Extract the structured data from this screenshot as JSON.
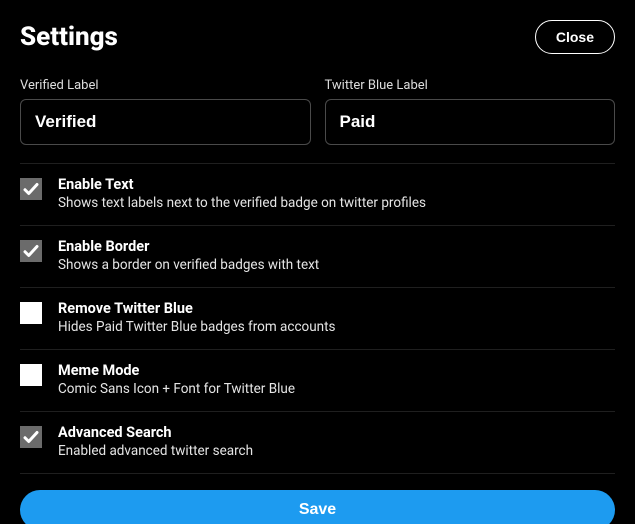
{
  "header": {
    "title": "Settings",
    "close_label": "Close"
  },
  "fields": {
    "verified": {
      "label": "Verified Label",
      "value": "Verified"
    },
    "twitter_blue": {
      "label": "Twitter Blue Label",
      "value": "Paid"
    }
  },
  "options": [
    {
      "title": "Enable Text",
      "desc": "Shows text labels next to the verified badge on twitter profiles",
      "checked": true
    },
    {
      "title": "Enable Border",
      "desc": "Shows a border on verified badges with text",
      "checked": true
    },
    {
      "title": "Remove Twitter Blue",
      "desc": "Hides Paid Twitter Blue badges from accounts",
      "checked": false
    },
    {
      "title": "Meme Mode",
      "desc": "Comic Sans Icon + Font for Twitter Blue",
      "checked": false
    },
    {
      "title": "Advanced Search",
      "desc": "Enabled advanced twitter search",
      "checked": true
    }
  ],
  "footer": {
    "save_label": "Save"
  }
}
